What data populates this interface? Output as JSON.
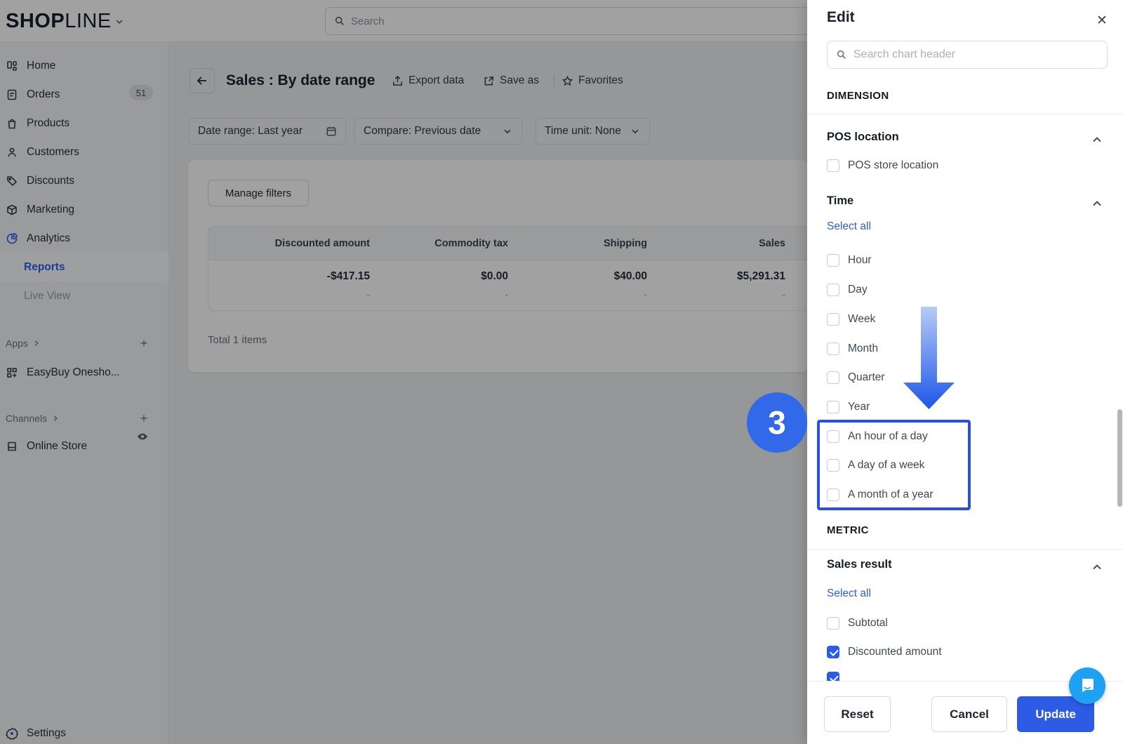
{
  "colors": {
    "accent": "#2b5ce8",
    "highlight_border": "#2b50e0",
    "fab": "#1da2f3",
    "update_button": "#2e5be6"
  },
  "topbar": {
    "logo_bold": "SHOP",
    "logo_light": "LINE",
    "search_placeholder": "Search"
  },
  "sidebar": {
    "items": [
      {
        "label": "Home"
      },
      {
        "label": "Orders",
        "badge": "51"
      },
      {
        "label": "Products"
      },
      {
        "label": "Customers"
      },
      {
        "label": "Discounts"
      },
      {
        "label": "Marketing"
      },
      {
        "label": "Analytics"
      },
      {
        "label": "Reports",
        "active": true
      },
      {
        "label": "Live View"
      }
    ],
    "apps_header": "Apps",
    "apps_items": [
      {
        "label": "EasyBuy Onesho..."
      }
    ],
    "channels_header": "Channels",
    "channels_items": [
      {
        "label": "Online Store"
      }
    ],
    "settings_label": "Settings"
  },
  "main": {
    "title": "Sales : By date range",
    "actions": {
      "export": "Export data",
      "save_as": "Save as",
      "favorites": "Favorites"
    },
    "filters": [
      "Date range: Last year",
      "Compare: Previous date",
      "Time unit: None"
    ],
    "manage_filters": "Manage filters",
    "table": {
      "headers": [
        "Discounted amount",
        "Commodity tax",
        "Shipping",
        "Sales"
      ],
      "row": [
        "-$417.15",
        "$0.00",
        "$40.00",
        "$5,291.31"
      ],
      "sub_row": [
        "-",
        "-",
        "-",
        "-"
      ],
      "total": "Total 1 items"
    }
  },
  "edit_panel": {
    "title": "Edit",
    "search_placeholder": "Search chart header",
    "dimension_label": "DIMENSION",
    "metric_label": "METRIC",
    "groups": {
      "pos": {
        "title": "POS location",
        "items": [
          {
            "label": "POS store location",
            "checked": false
          }
        ]
      },
      "time": {
        "title": "Time",
        "select_all": "Select all",
        "items": [
          {
            "label": "Hour",
            "checked": false
          },
          {
            "label": "Day",
            "checked": false
          },
          {
            "label": "Week",
            "checked": false
          },
          {
            "label": "Month",
            "checked": false
          },
          {
            "label": "Quarter",
            "checked": false
          },
          {
            "label": "Year",
            "checked": false
          }
        ],
        "highlighted_items": [
          {
            "label": "An hour of a day",
            "checked": false
          },
          {
            "label": "A day of a week",
            "checked": false
          },
          {
            "label": "A month of a year",
            "checked": false
          }
        ]
      },
      "sales": {
        "title": "Sales result",
        "select_all": "Select all",
        "items": [
          {
            "label": "Subtotal",
            "checked": false
          },
          {
            "label": "Discounted amount",
            "checked": true
          },
          {
            "label": "",
            "checked": true
          }
        ]
      }
    },
    "footer": {
      "reset": "Reset",
      "cancel": "Cancel",
      "update": "Update"
    }
  },
  "annotation": {
    "step": "3"
  }
}
